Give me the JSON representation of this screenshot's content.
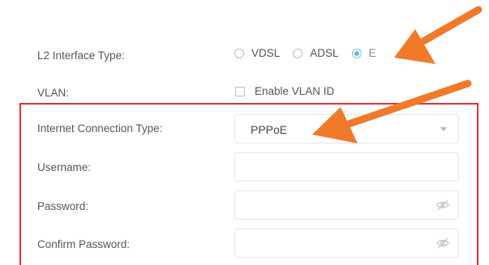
{
  "l2_interface": {
    "label": "L2 Interface Type:",
    "options": [
      {
        "label": "VDSL",
        "selected": false
      },
      {
        "label": "ADSL",
        "selected": false
      },
      {
        "label": "E",
        "selected": true
      }
    ]
  },
  "vlan": {
    "label": "VLAN:",
    "checkbox_label": "Enable VLAN ID",
    "checked": false
  },
  "internet_connection": {
    "label": "Internet Connection Type:",
    "value": "PPPoE",
    "icon": "chevron-down-icon"
  },
  "username": {
    "label": "Username:",
    "value": ""
  },
  "password": {
    "label": "Password:",
    "value": "",
    "icon": "eye-slash-icon"
  },
  "confirm_password": {
    "label": "Confirm Password:",
    "value": "",
    "icon": "eye-slash-icon"
  },
  "annotations": {
    "arrow_color": "#f07a2a",
    "highlight_color": "#e03131"
  }
}
